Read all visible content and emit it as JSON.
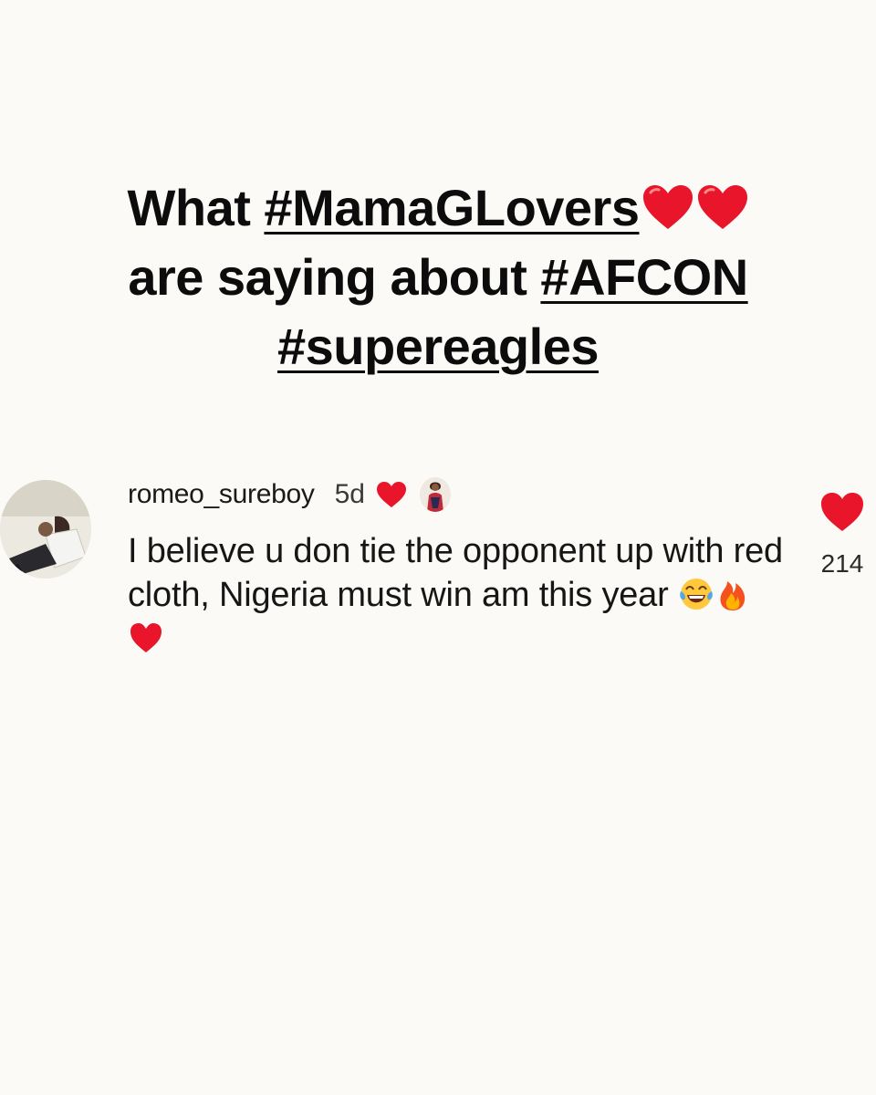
{
  "headline": {
    "line1_text": "What ",
    "line1_tag": "#MamaGLovers",
    "line2_text": "are saying about ",
    "line2_tag": "#AFCON",
    "line3_tag": "#supereagles",
    "icons": [
      "red-heart-icon",
      "red-heart-icon"
    ]
  },
  "comment": {
    "username": "romeo_sureboy",
    "time": "5d",
    "text": "I believe u don tie the opponent up with red cloth, Nigeria must win am this year",
    "emojis": [
      "face-with-tears-of-joy-icon",
      "fire-icon",
      "red-heart-icon"
    ],
    "likes": "214",
    "liked_by_author": true
  },
  "colors": {
    "background": "#fbfaf7",
    "heart": "#e8152b",
    "text": "#111111"
  }
}
